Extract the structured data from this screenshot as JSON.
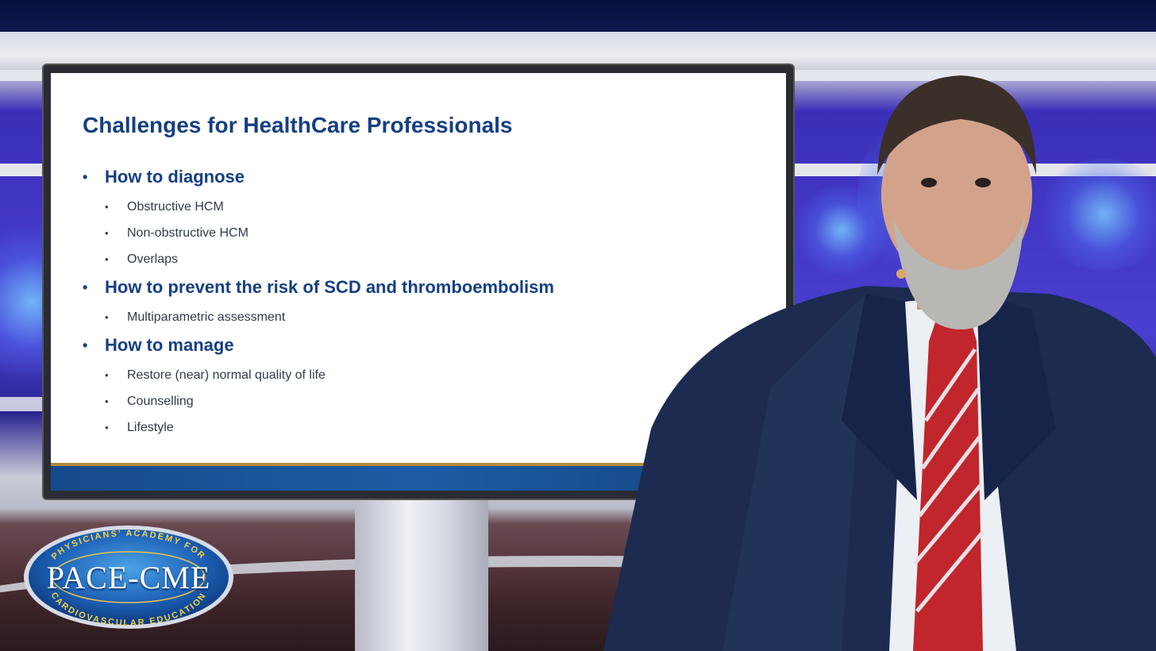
{
  "slide": {
    "title": "Challenges for HealthCare Professionals",
    "sections": [
      {
        "heading": "How to diagnose",
        "items": [
          "Obstructive HCM",
          "Non-obstructive HCM",
          "Overlaps"
        ]
      },
      {
        "heading": "How to prevent the risk of SCD and thromboembolism",
        "items": [
          "Multiparametric assessment"
        ]
      },
      {
        "heading": "How to manage",
        "items": [
          "Restore (near) normal quality of life",
          "Counselling",
          "Lifestyle"
        ]
      }
    ]
  },
  "logo": {
    "top_arc": "PHYSICIANS' ACADEMY FOR",
    "name": "PACE-CME",
    "bottom_arc": "CARDIOVASCULAR EDUCATION"
  },
  "colors": {
    "slide_heading": "#163f82",
    "slide_text": "#303a4a",
    "slide_bar": "#1d5ca6",
    "studio_purple": "#4a3fd0"
  }
}
